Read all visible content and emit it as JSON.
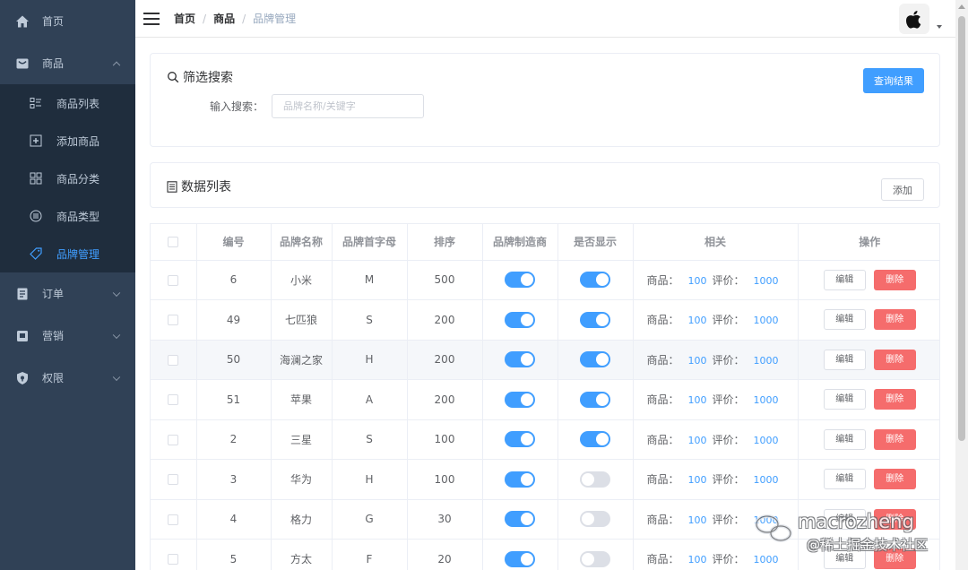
{
  "sidebar": {
    "items": [
      {
        "label": "首页",
        "icon": "home-icon"
      },
      {
        "label": "商品",
        "icon": "product-icon",
        "expanded": true,
        "children": [
          {
            "label": "商品列表",
            "icon": "list-icon"
          },
          {
            "label": "添加商品",
            "icon": "add-box-icon"
          },
          {
            "label": "商品分类",
            "icon": "grid-icon"
          },
          {
            "label": "商品类型",
            "icon": "type-icon"
          },
          {
            "label": "品牌管理",
            "icon": "tag-icon",
            "active": true
          }
        ]
      },
      {
        "label": "订单",
        "icon": "order-icon"
      },
      {
        "label": "营销",
        "icon": "marketing-icon"
      },
      {
        "label": "权限",
        "icon": "shield-icon"
      }
    ],
    "bg_color": "#304156",
    "active_color": "#409eff"
  },
  "header": {
    "breadcrumb": [
      "首页",
      "商品",
      "品牌管理"
    ],
    "avatar_icon": "apple-logo-icon"
  },
  "filter": {
    "title": "筛选搜索",
    "query_button": "查询结果",
    "search_label": "输入搜索：",
    "search_placeholder": "品牌名称/关键字",
    "search_value": ""
  },
  "list": {
    "title": "数据列表",
    "add_button": "添加"
  },
  "table": {
    "headers": [
      "编号",
      "品牌名称",
      "品牌首字母",
      "排序",
      "品牌制造商",
      "是否显示",
      "相关",
      "操作"
    ],
    "related_product_label": "商品：",
    "related_review_label": "评价：",
    "edit_label": "编辑",
    "delete_label": "删除",
    "rows": [
      {
        "id": "6",
        "name": "小米",
        "letter": "M",
        "sort": "500",
        "factory": true,
        "show": true,
        "products": "100",
        "reviews": "1000"
      },
      {
        "id": "49",
        "name": "七匹狼",
        "letter": "S",
        "sort": "200",
        "factory": true,
        "show": true,
        "products": "100",
        "reviews": "1000"
      },
      {
        "id": "50",
        "name": "海澜之家",
        "letter": "H",
        "sort": "200",
        "factory": true,
        "show": true,
        "products": "100",
        "reviews": "1000"
      },
      {
        "id": "51",
        "name": "苹果",
        "letter": "A",
        "sort": "200",
        "factory": true,
        "show": true,
        "products": "100",
        "reviews": "1000"
      },
      {
        "id": "2",
        "name": "三星",
        "letter": "S",
        "sort": "100",
        "factory": true,
        "show": true,
        "products": "100",
        "reviews": "1000"
      },
      {
        "id": "3",
        "name": "华为",
        "letter": "H",
        "sort": "100",
        "factory": true,
        "show": false,
        "products": "100",
        "reviews": "1000"
      },
      {
        "id": "4",
        "name": "格力",
        "letter": "G",
        "sort": "30",
        "factory": true,
        "show": false,
        "products": "100",
        "reviews": "1000"
      },
      {
        "id": "5",
        "name": "方太",
        "letter": "F",
        "sort": "20",
        "factory": true,
        "show": false,
        "products": "100",
        "reviews": "1000"
      }
    ]
  },
  "watermark": {
    "line1": "macrozheng",
    "line2": "@稀土掘金技术社区"
  }
}
